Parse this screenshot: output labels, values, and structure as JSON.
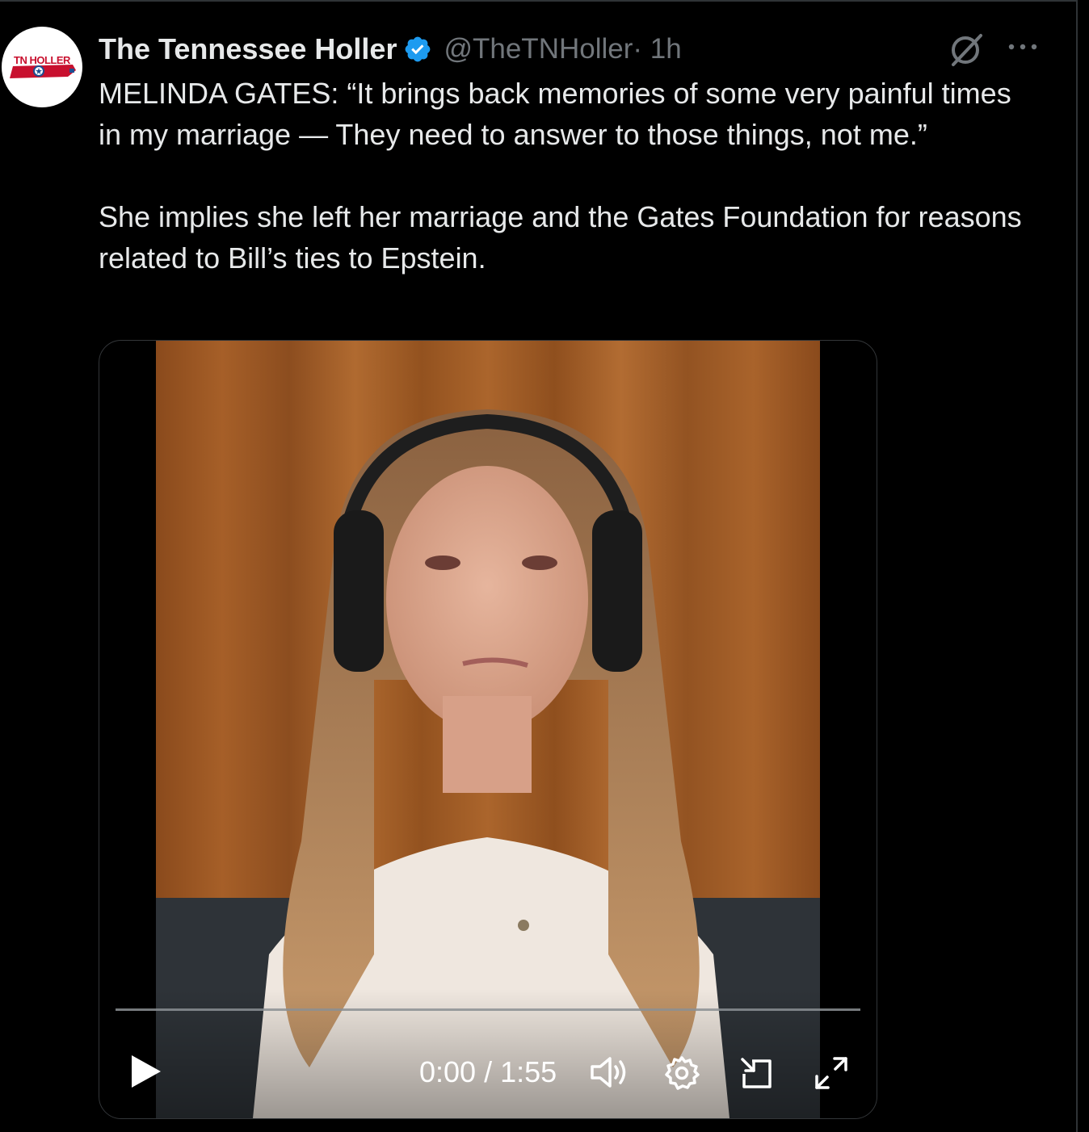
{
  "author": {
    "display_name": "The Tennessee Holler",
    "handle": "@TheTNHoller",
    "time_ago": " · 1h",
    "avatar_text": "TN HOLLER",
    "verified_color": "#1d9bf0"
  },
  "tweet": {
    "line1": "MELINDA GATES: “It brings back memories of some very painful times in my marriage — They need to answer to those things, not me.”",
    "line2": "She implies she left her marriage and the Gates Foundation for reasons related to Bill’s ties to Epstein."
  },
  "video": {
    "time_readout": "0:00 / 1:55",
    "progress": 0,
    "icons": [
      "play-icon",
      "volume-icon",
      "settings-icon",
      "picture-in-picture-icon",
      "fullscreen-icon"
    ]
  },
  "header_icons": [
    "grok-icon",
    "more-icon"
  ],
  "colors": {
    "background": "#000000",
    "text": "#e7e9ea",
    "muted": "#71767b",
    "accent": "#1d9bf0"
  }
}
